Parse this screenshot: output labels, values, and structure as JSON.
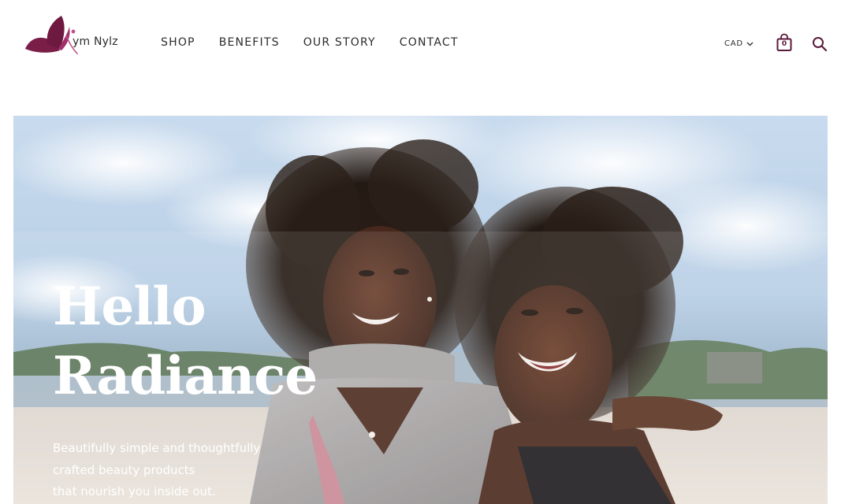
{
  "brand": {
    "name": "Kym Nylz",
    "wordmark": "ym Nylz",
    "logo_color": "#7a1e48",
    "logo_accent": "#c2508a"
  },
  "nav": {
    "items": [
      {
        "label": "SHOP"
      },
      {
        "label": "BENEFITS"
      },
      {
        "label": "OUR STORY"
      },
      {
        "label": "CONTACT"
      }
    ]
  },
  "header_tools": {
    "currency": "CAD",
    "cart_count": "0",
    "icons": [
      "chevron-down-icon",
      "shopping-bag-icon",
      "search-icon"
    ]
  },
  "hero": {
    "title_line1": "Hello",
    "title_line2": "Radiance",
    "subtitle_line1": "Beautifully simple and thoughtfully",
    "subtitle_line2": "crafted beauty products",
    "subtitle_line3": "that nourish you inside out.",
    "image_subject": "two smiling women with natural curly hair on a beach"
  },
  "colors": {
    "text": "#2b2b2b",
    "hero_text": "#ffffff",
    "brand": "#7a1e48"
  }
}
